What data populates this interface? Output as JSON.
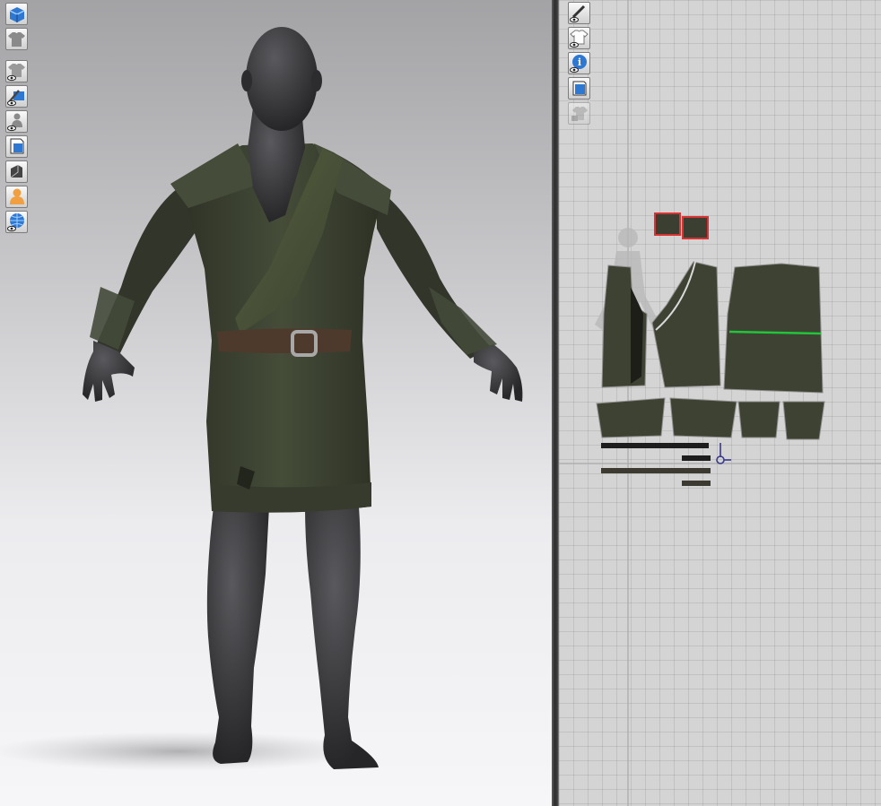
{
  "app": {
    "accent": "#2f78d2",
    "selection_color": "#d83232",
    "seam_color": "#22c43a"
  },
  "viewport_3d": {
    "toolbar": [
      {
        "icon": "blue-box-icon",
        "active": true
      },
      {
        "icon": "garment-shirt-icon",
        "active": false
      },
      {
        "icon": "show-garment-icon",
        "active": false
      },
      {
        "icon": "show-texture-brush-icon",
        "active": false
      },
      {
        "icon": "show-avatar-icon",
        "active": false
      },
      {
        "icon": "fabric-sheet-icon",
        "active": false
      },
      {
        "icon": "render-box-icon",
        "active": false
      },
      {
        "icon": "avatar-skin-icon",
        "active": false
      },
      {
        "icon": "globe-grid-icon",
        "active": false
      }
    ],
    "avatar": {
      "skin_color": "#3b3b3d"
    },
    "garment": {
      "fabric_color": "#3e4433",
      "belt_color": "#4e3a2c",
      "buckle_color": "#a8a8a8"
    }
  },
  "viewport_2d": {
    "toolbar": [
      {
        "icon": "show-2d-brush-icon",
        "active": false
      },
      {
        "icon": "show-pattern-shirt-icon",
        "active": false
      },
      {
        "icon": "info-icon",
        "active": false
      },
      {
        "icon": "texture-layer-icon",
        "active": false
      },
      {
        "icon": "lock-shirt-icon",
        "active": false
      }
    ]
  }
}
